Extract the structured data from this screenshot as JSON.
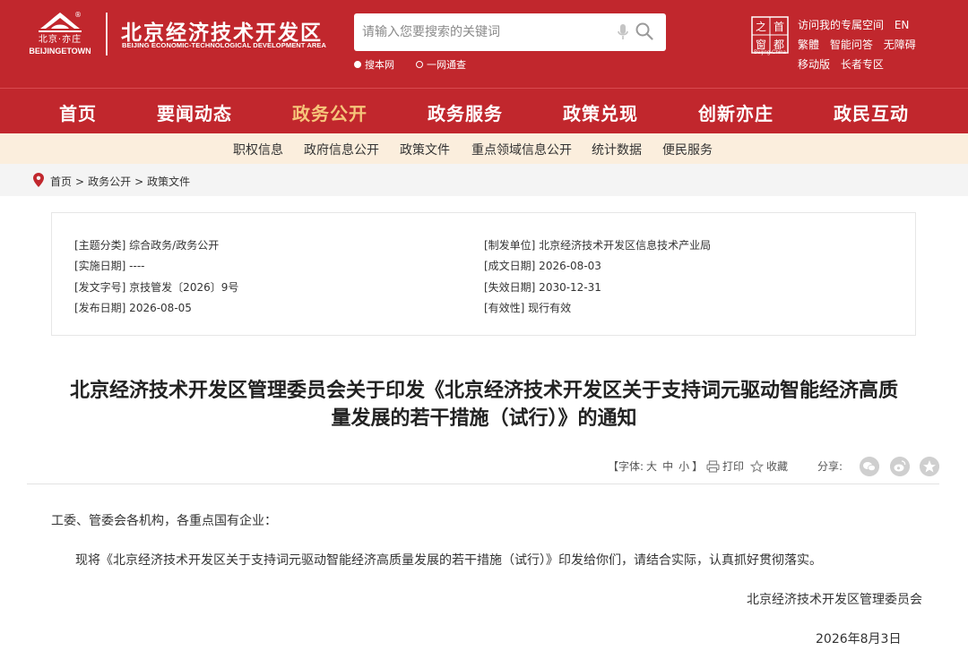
{
  "header": {
    "logo_cn": "北京·亦庄",
    "logo_en": "BEIJINGETOWN",
    "reg_mark": "®",
    "site_title": "北京经济技术开发区",
    "site_subtitle": "BEIJING ECONOMIC-TECHNOLOGICAL DEVELOPMENT AREA",
    "search_placeholder": "请输入您要搜索的关键词",
    "scope_options": [
      "搜本网",
      "一网通查"
    ],
    "capital_logo_text": [
      "之",
      "首",
      "窗",
      "都"
    ],
    "capital_caption": "Beijing-China",
    "top_links_row1": [
      "访问我的专属空间",
      "EN"
    ],
    "top_links_row2": [
      "繁體",
      "智能问答",
      "无障碍"
    ],
    "top_links_row3": [
      "移动版",
      "长者专区"
    ]
  },
  "mainnav": [
    "首页",
    "要闻动态",
    "政务公开",
    "政务服务",
    "政策兑现",
    "创新亦庄",
    "政民互动"
  ],
  "subnav": [
    "职权信息",
    "政府信息公开",
    "政策文件",
    "重点领域信息公开",
    "统计数据",
    "便民服务"
  ],
  "breadcrumb": [
    "首页",
    "政务公开",
    "政策文件"
  ],
  "breadcrumb_sep": ">",
  "meta": {
    "left": [
      "[主题分类] 综合政务/政务公开",
      "[实施日期] ----",
      "[发文字号] 京技管发〔2026〕9号",
      "[发布日期] 2026-08-05"
    ],
    "right": [
      "[制发单位] 北京经济技术开发区信息技术产业局",
      "[成文日期] 2026-08-03",
      "[失效日期] 2030-12-31",
      "[有效性] 现行有效"
    ]
  },
  "article": {
    "title_line1": "北京经济技术开发区管理委员会关于印发《北京经济技术开发区关于支持词元驱动智能经济高质",
    "title_line2": "量发展的若干措施（试行）》的通知",
    "font_label": "【字体:",
    "font_sizes": [
      "大",
      "中",
      "小"
    ],
    "font_end": "】",
    "print": "打印",
    "favorite": "收藏",
    "share": "分享:",
    "salutation": "工委、管委会各机构，各重点国有企业：",
    "body": "现将《北京经济技术开发区关于支持词元驱动智能经济高质量发展的若干措施（试行）》印发给你们，请结合实际，认真抓好贯彻落实。",
    "signature": "北京经济技术开发区管理委员会",
    "date": "2026年8月3日"
  },
  "colors": {
    "brand_red": "#c1272d",
    "active_nav": "#f6c57a",
    "subnav_bg": "#fbeedd"
  }
}
